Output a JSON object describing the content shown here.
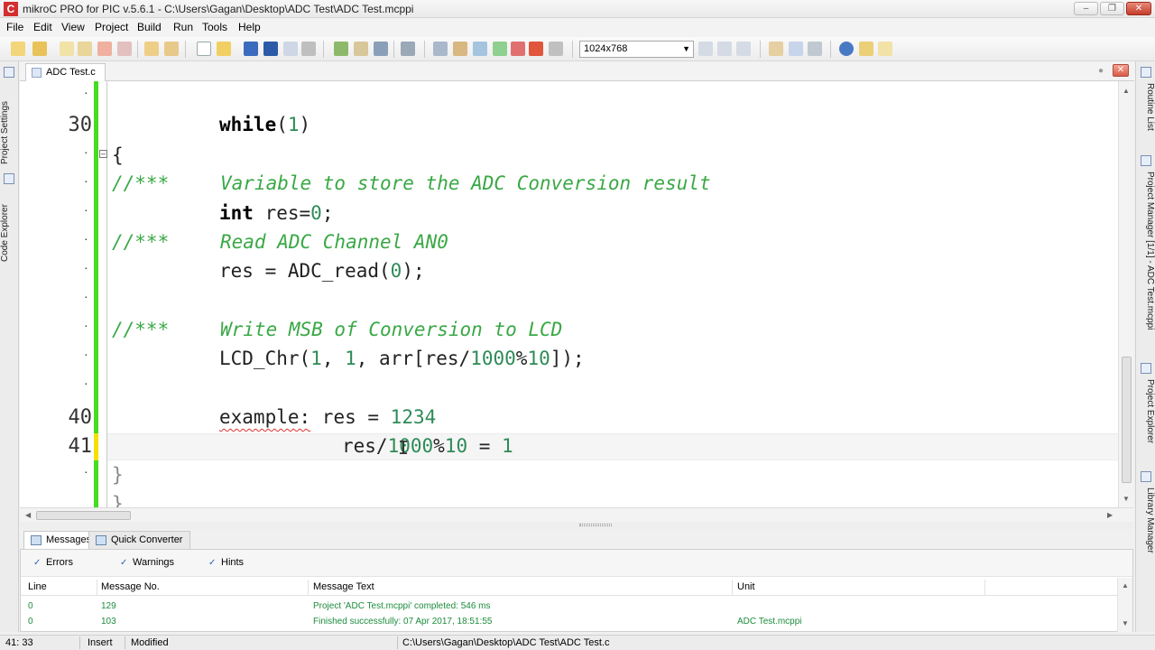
{
  "window": {
    "title": "mikroC PRO for PIC v.5.6.1 - C:\\Users\\Gagan\\Desktop\\ADC Test\\ADC Test.mcppi",
    "logo": "C"
  },
  "menu": [
    "File",
    "Edit",
    "View",
    "Project",
    "Build",
    "Run",
    "Tools",
    "Help"
  ],
  "toolbar": {
    "resolution_value": "1024x768",
    "icons": [
      "new-file-icon",
      "open-icon",
      "save-icon",
      "save-all-icon",
      "print-icon",
      "build-icon",
      "run-icon",
      "debug-icon",
      "help-icon"
    ]
  },
  "left_dock": {
    "tabs": [
      "Project Settings",
      "Code Explorer"
    ]
  },
  "right_dock": {
    "tabs": [
      "Routine List",
      "Project Manager [1/1] - ADC Test.mcppi",
      "Project Explorer",
      "Library Manager"
    ]
  },
  "editor": {
    "tab_label": "ADC Test.c",
    "line_numbers": {
      "l30": "30",
      "l40": "40",
      "l41": "41"
    },
    "lines": {
      "while_kw": "while",
      "while_paren_open": "(",
      "while_arg": "1",
      "while_paren_close": ")",
      "brace_open": "{",
      "c1_prefix": "//***",
      "c1_text": "Variable to store the ADC Conversion result",
      "int_kw": "int",
      "int_rest_a": " res=",
      "int_val": "0",
      "int_rest_b": ";",
      "c2_prefix": "//***",
      "c2_text": "Read ADC Channel AN0",
      "read_a": "res = ADC_read(",
      "read_val": "0",
      "read_b": ");",
      "c3_prefix": "//***",
      "c3_text": "Write MSB of Conversion to LCD",
      "lcd_a": "LCD_Chr(",
      "lcd_n1": "1",
      "lcd_sep1": ", ",
      "lcd_n2": "1",
      "lcd_b": ", arr[res/",
      "lcd_n3": "1000",
      "lcd_c": "%",
      "lcd_n4": "10",
      "lcd_d": "]);",
      "ex_label": "example:",
      "ex_a": " res = ",
      "ex_val": "1234",
      "l41_a": "res/",
      "l41_n1": "1000",
      "l41_b": "%",
      "l41_n2": "10",
      "l41_c": " = ",
      "l41_n3": "1",
      "brace_close": "}",
      "brace_close2": "}"
    }
  },
  "messages": {
    "tabs": [
      "Messages",
      "Quick Converter"
    ],
    "filters": [
      "Errors",
      "Warnings",
      "Hints"
    ],
    "columns": [
      "Line",
      "Message No.",
      "Message Text",
      "Unit"
    ],
    "rows": [
      {
        "line": "0",
        "no": "129",
        "text": "Project 'ADC Test.mcppi' completed: 546 ms",
        "unit": ""
      },
      {
        "line": "0",
        "no": "103",
        "text": "Finished successfully: 07 Apr 2017, 18:51:55",
        "unit": "ADC Test.mcppi"
      }
    ]
  },
  "status": {
    "position": "41: 33",
    "mode": "Insert",
    "modified": "Modified",
    "path": "C:\\Users\\Gagan\\Desktop\\ADC Test\\ADC Test.c"
  },
  "colors": {
    "comment": "#3aa845",
    "number": "#2e8b57",
    "gutter_marker": "#44dd22",
    "current_line_marker": "#f4e100",
    "message_ok": "#1c8c3c"
  }
}
